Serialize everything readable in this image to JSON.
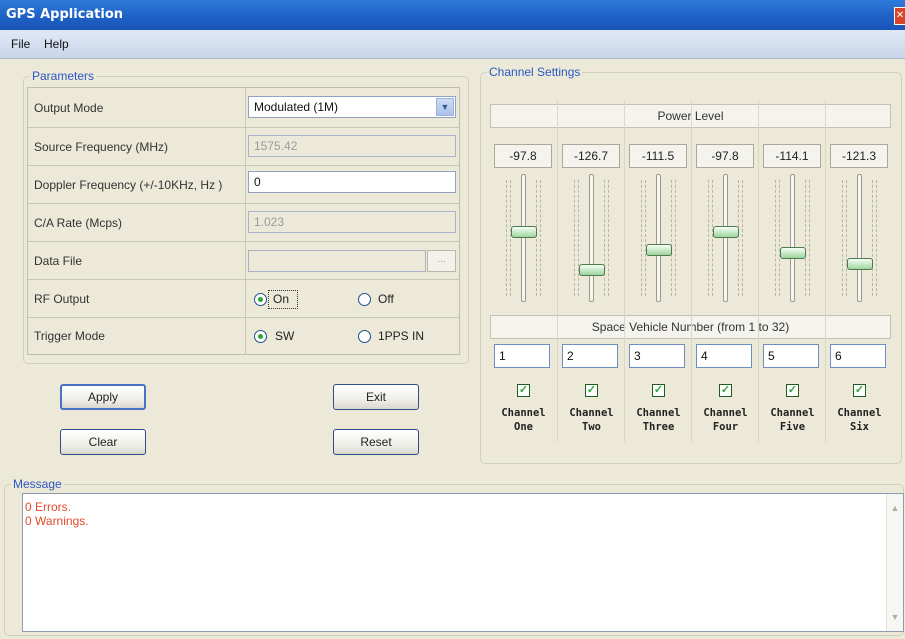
{
  "window": {
    "title": "GPS Application"
  },
  "menu": {
    "items": [
      "File",
      "Help"
    ]
  },
  "parameters": {
    "legend": "Parameters",
    "output_mode": {
      "label": "Output Mode",
      "value": "Modulated (1M)"
    },
    "source_frequency": {
      "label": "Source Frequency (MHz)",
      "value": "1575.42"
    },
    "doppler_frequency": {
      "label": "Doppler Frequency (+/-10KHz, Hz )",
      "value": "0"
    },
    "ca_rate": {
      "label": "C/A Rate (Mcps)",
      "value": "1.023"
    },
    "data_file": {
      "label": "Data File",
      "value": "",
      "browse": "..."
    },
    "rf_output": {
      "label": "RF Output",
      "options": [
        "On",
        "Off"
      ],
      "selected": "On"
    },
    "trigger_mode": {
      "label": "Trigger Mode",
      "options": [
        "SW",
        "1PPS IN"
      ],
      "selected": "SW"
    }
  },
  "buttons": {
    "apply": "Apply",
    "exit": "Exit",
    "clear": "Clear",
    "reset": "Reset"
  },
  "channel_settings": {
    "legend": "Channel Settings",
    "power_level_label": "Power Level",
    "sv_label": "Space Vehicle Number (from 1 to 32)",
    "channels": [
      {
        "name": "Channel One",
        "power": "-97.8",
        "sv": "1",
        "enabled": true,
        "slider_level": 0.55
      },
      {
        "name": "Channel Two",
        "power": "-126.7",
        "sv": "2",
        "enabled": true,
        "slider_level": 0.22
      },
      {
        "name": "Channel Three",
        "power": "-111.5",
        "sv": "3",
        "enabled": true,
        "slider_level": 0.4
      },
      {
        "name": "Channel Four",
        "power": "-97.8",
        "sv": "4",
        "enabled": true,
        "slider_level": 0.55
      },
      {
        "name": "Channel Five",
        "power": "-114.1",
        "sv": "5",
        "enabled": true,
        "slider_level": 0.37
      },
      {
        "name": "Channel Six",
        "power": "-121.3",
        "sv": "6",
        "enabled": true,
        "slider_level": 0.28
      }
    ]
  },
  "message": {
    "legend": "Message",
    "lines": [
      "0 Errors.",
      "0 Warnings."
    ],
    "color": "#e04b2e"
  },
  "colors": {
    "accent": "#2b57c4",
    "title_bar": "#1d5fc4",
    "check": "#2aa837"
  }
}
